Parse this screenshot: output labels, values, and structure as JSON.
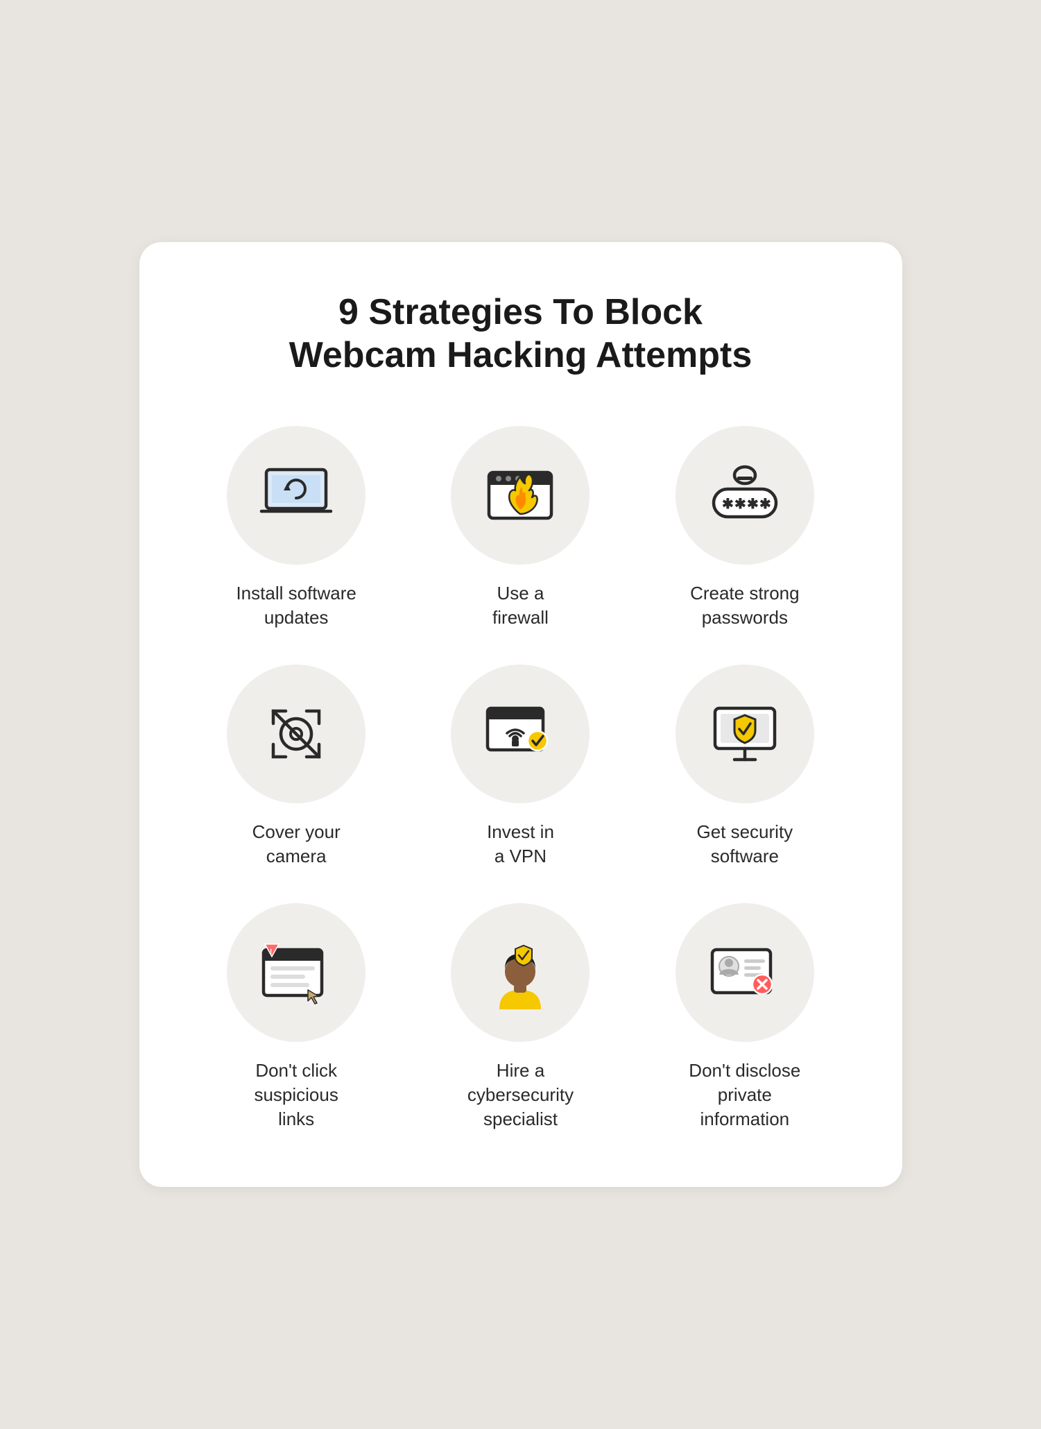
{
  "title": "9 Strategies To Block\nWebcam Hacking Attempts",
  "items": [
    {
      "id": "install-software-updates",
      "label": "Install software\nupdates",
      "icon": "laptop-refresh"
    },
    {
      "id": "use-a-firewall",
      "label": "Use a\nfirewall",
      "icon": "firewall"
    },
    {
      "id": "create-strong-passwords",
      "label": "Create strong\npasswords",
      "icon": "password"
    },
    {
      "id": "cover-your-camera",
      "label": "Cover your\ncamera",
      "icon": "camera-cover"
    },
    {
      "id": "invest-in-a-vpn",
      "label": "Invest in\na VPN",
      "icon": "vpn"
    },
    {
      "id": "get-security-software",
      "label": "Get security\nsoftware",
      "icon": "security-software"
    },
    {
      "id": "dont-click-suspicious-links",
      "label": "Don't click\nsuspicious\nlinks",
      "icon": "suspicious-links"
    },
    {
      "id": "hire-cybersecurity-specialist",
      "label": "Hire a\ncybersecurity\nspecialist",
      "icon": "specialist"
    },
    {
      "id": "dont-disclose-private-info",
      "label": "Don't disclose\nprivate\ninformation",
      "icon": "private-info"
    }
  ],
  "colors": {
    "background": "#e8e4df",
    "card": "#ffffff",
    "icon_bg": "#f0eeeb",
    "title": "#1a1a1a",
    "label": "#2a2a2a",
    "yellow": "#f5c800",
    "stroke": "#2a2a2a"
  }
}
